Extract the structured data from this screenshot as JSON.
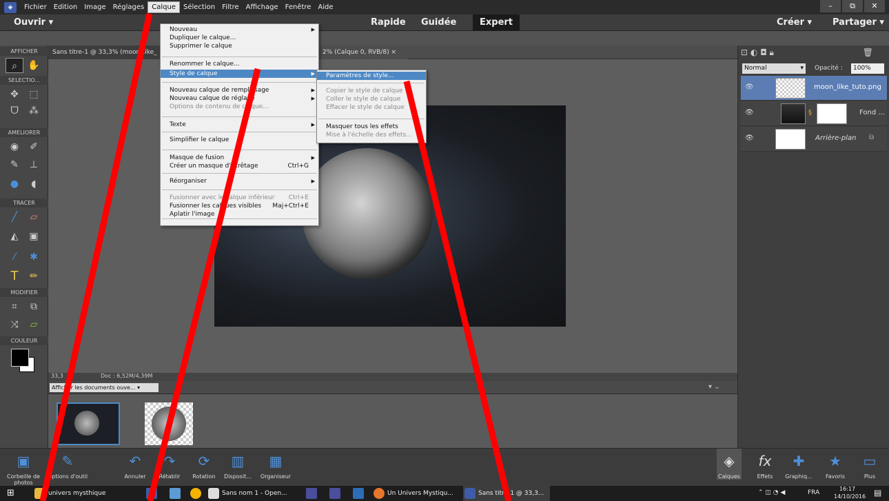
{
  "menubar": {
    "items": [
      "Fichier",
      "Edition",
      "Image",
      "Réglages",
      "Calque",
      "Sélection",
      "Filtre",
      "Affichage",
      "Fenêtre",
      "Aide"
    ],
    "active": "Calque"
  },
  "modebar": {
    "open": "Ouvrir",
    "rapide": "Rapide",
    "guidee": "Guidée",
    "expert": "Expert",
    "creer": "Créer",
    "partager": "Partager"
  },
  "toolbox": {
    "sections": [
      "AFFICHER",
      "SELECTIO...",
      "AMELIORER",
      "TRACER",
      "MODIFIER",
      "COULEUR"
    ]
  },
  "tabs": [
    "Sans titre-1 @ 33,3% (moon_like_",
    "2% (Calque 0, RVB/8)"
  ],
  "tab_close": "×",
  "status": {
    "zoom": "33,3",
    "doc": "Doc : 6,52M/4,39M"
  },
  "bin": {
    "show_docs": "Afficher les documents ouve..."
  },
  "calque_menu": {
    "items": [
      {
        "label": "Nouveau",
        "arrow": true
      },
      {
        "label": "Dupliquer le calque..."
      },
      {
        "label": "Supprimer le calque"
      },
      {
        "label": "Renommer le calque..."
      },
      {
        "label": "Style de calque",
        "arrow": true,
        "highlight": true
      },
      {
        "label": "Nouveau calque de remplissage",
        "arrow": true
      },
      {
        "label": "Nouveau calque de réglage",
        "arrow": true
      },
      {
        "label": "Options de contenu de calque...",
        "disabled": true
      },
      {
        "label": "Texte",
        "arrow": true
      },
      {
        "label": "Simplifier le calque"
      },
      {
        "label": "Masque de fusion",
        "arrow": true
      },
      {
        "label": "Créer un masque d'écrêtage",
        "shortcut": "Ctrl+G"
      },
      {
        "label": "Réorganiser",
        "arrow": true
      },
      {
        "label": "Fusionner avec le calque inférieur",
        "shortcut": "Ctrl+E",
        "disabled": true
      },
      {
        "label": "Fusionner les calques visibles",
        "shortcut": "Maj+Ctrl+E"
      },
      {
        "label": "Aplatir l'image"
      }
    ]
  },
  "style_submenu": {
    "items": [
      {
        "label": "Paramètres de style...",
        "highlight": true
      },
      {
        "label": "Copier le style de calque",
        "disabled": true
      },
      {
        "label": "Coller le style de calque",
        "disabled": true
      },
      {
        "label": "Effacer le style de calque",
        "disabled": true
      },
      {
        "label": "Masquer tous les effets"
      },
      {
        "label": "Mise à l'échelle des effets...",
        "disabled": true
      }
    ]
  },
  "layers_panel": {
    "blend": "Normal",
    "opacity_label": "Opacité :",
    "opacity": "100%",
    "layers": [
      {
        "name": "moon_like_tuto.png",
        "selected": true
      },
      {
        "name": "Fond ..."
      },
      {
        "name": "Arrière-plan"
      }
    ]
  },
  "bottombar": {
    "left": [
      "Corbeille de photos",
      "Options d'outil",
      "Annuler",
      "Rétablir",
      "Rotation",
      "Disposit...",
      "Organiseur"
    ],
    "right": [
      "Calques",
      "Effets",
      "Graphiq...",
      "Favoris",
      "Plus"
    ]
  },
  "taskbar": {
    "items": [
      "univers mysthique",
      "Sans nom 1 - Open...",
      "Un Univers Mystiqu...",
      "Sans titre-1 @ 33,3..."
    ],
    "lang": "FRA",
    "time": "16:17",
    "date": "14/10/2016"
  },
  "colors": {
    "accent": "#4d88c5",
    "selected_layer": "#5b7db3",
    "annotation": "#ff0000"
  }
}
